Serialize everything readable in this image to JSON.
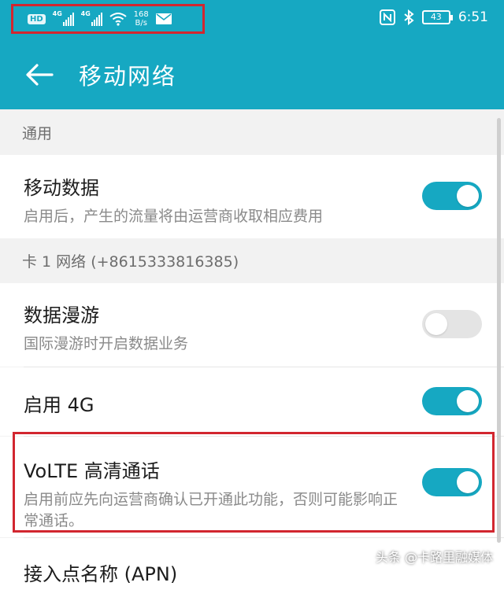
{
  "status_bar": {
    "hd": "HD",
    "sim1": "4G",
    "sim2": "4G",
    "speed_value": "168",
    "speed_unit": "B/s",
    "battery": "43",
    "time": "6:51"
  },
  "header": {
    "title": "移动网络"
  },
  "sections": {
    "general": {
      "label": "通用"
    },
    "sim1": {
      "label": "卡 1 网络 (+8615333816385)"
    }
  },
  "settings": {
    "mobile_data": {
      "title": "移动数据",
      "subtitle": "启用后，产生的流量将由运营商收取相应费用",
      "enabled": true
    },
    "roaming": {
      "title": "数据漫游",
      "subtitle": "国际漫游时开启数据业务",
      "enabled": false
    },
    "enable_4g": {
      "title": "启用 4G",
      "enabled": true
    },
    "volte": {
      "title": "VoLTE 高清通话",
      "subtitle": "启用前应先向运营商确认已开通此功能，否则可能影响正常通话。",
      "enabled": true
    },
    "apn": {
      "title": "接入点名称 (APN)"
    }
  },
  "watermark": "头条 @卡路里融媒体",
  "colors": {
    "accent": "#16a8c2",
    "highlight": "#d2262f"
  }
}
